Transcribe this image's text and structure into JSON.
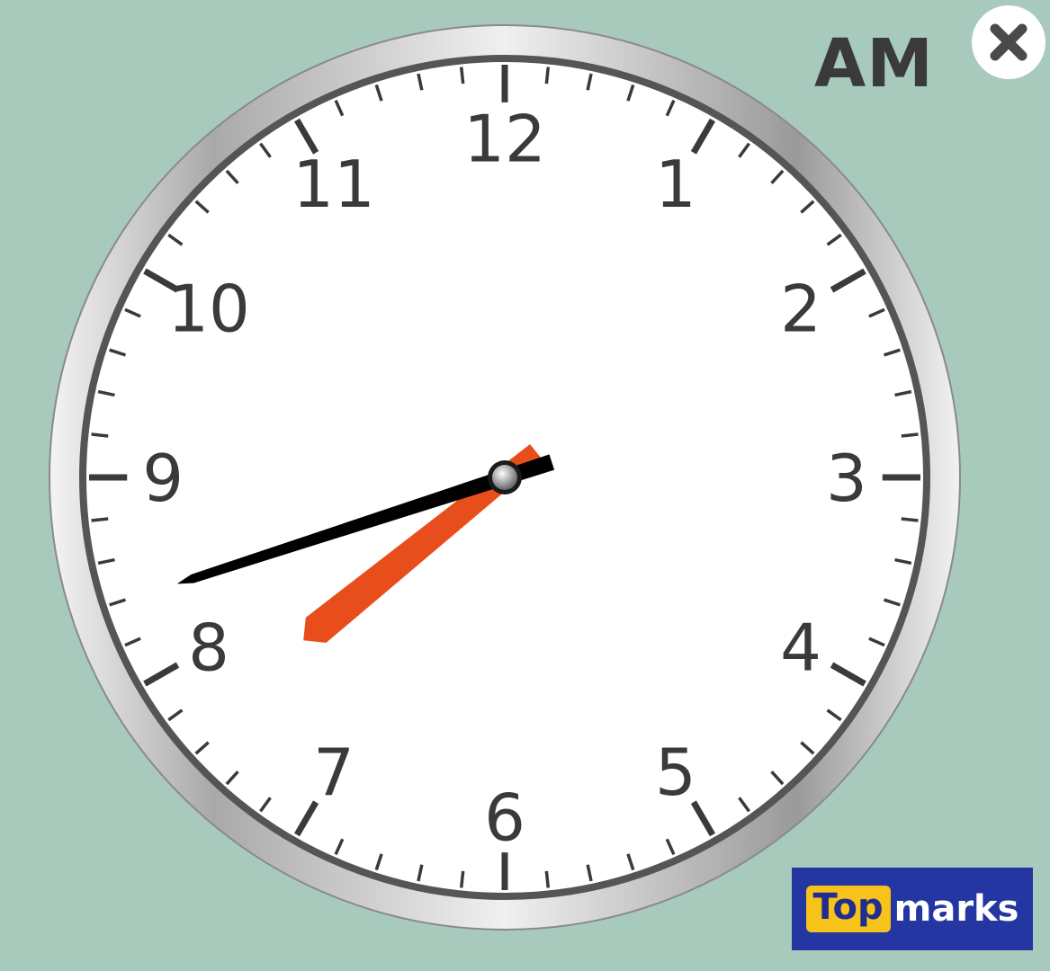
{
  "clock": {
    "numbers": [
      "12",
      "1",
      "2",
      "3",
      "4",
      "5",
      "6",
      "7",
      "8",
      "9",
      "10",
      "11"
    ],
    "period": "AM",
    "time": {
      "hour": 7,
      "minute": 42
    }
  },
  "controls": {
    "close_icon": "close-icon"
  },
  "branding": {
    "logo_part1": "Top",
    "logo_part2": "marks"
  },
  "colors": {
    "background": "#a8cabd",
    "face": "#ffffff",
    "hour_hand": "#e84e1b",
    "minute_hand": "#000000",
    "ink": "#3a3a3a",
    "logo_bg": "#2436a2",
    "logo_accent": "#f7c21a"
  }
}
